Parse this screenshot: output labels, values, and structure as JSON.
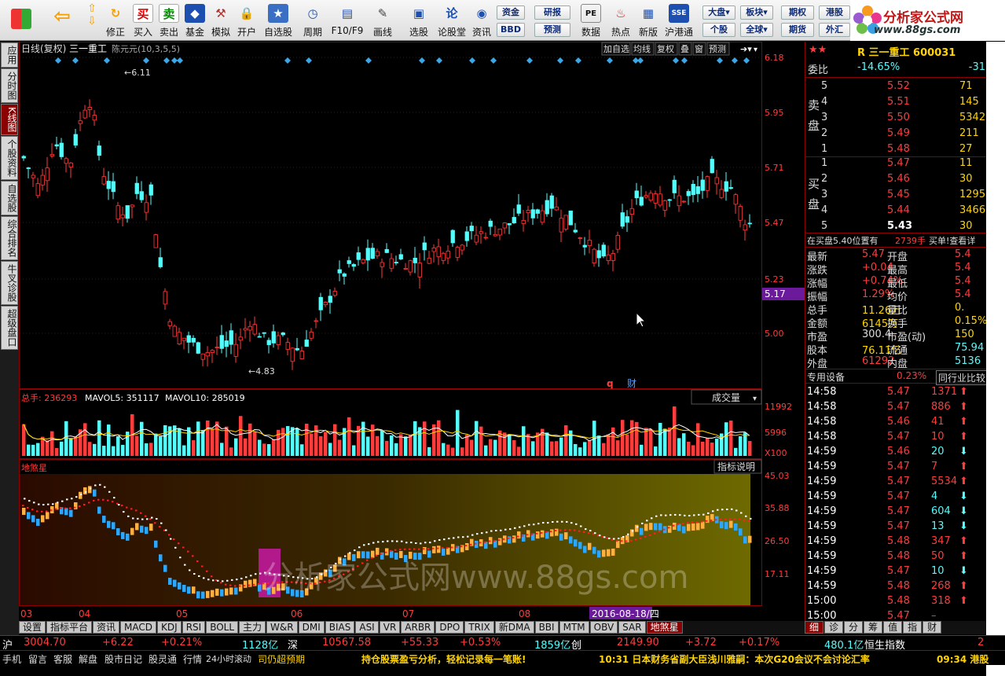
{
  "toolbar": {
    "items": [
      "修正",
      "买入",
      "卖出",
      "基金",
      "模拟",
      "开户",
      "自选股",
      "周期",
      "F10/F9",
      "画线",
      "选股",
      "论股堂",
      "资讯",
      "数据",
      "热点",
      "新版",
      "沪港通"
    ],
    "small_buttons": [
      "资金",
      "BBD",
      "研报",
      "预测",
      "大盘",
      "个股",
      "板块",
      "全球",
      "期权",
      "期货",
      "港股",
      "外汇"
    ],
    "logo": {
      "title": "分析家公式网",
      "url": "www.88gs.com"
    }
  },
  "sidetabs": [
    "应用",
    "分时图",
    "K线图",
    "个股资料",
    "自选股",
    "综合排名",
    "牛叉诊股",
    "超级盘口"
  ],
  "chart": {
    "header": {
      "period": "日线(复权)",
      "stock": "三一重工",
      "ma_label": "陈元元(10,3,5,5)"
    },
    "buttons": [
      "加自选",
      "均线",
      "复权",
      "叠",
      "窗",
      "预测"
    ],
    "price_axis": [
      "6.18",
      "5.95",
      "5.71",
      "5.47",
      "5.23",
      "5.00"
    ],
    "current_price": "5.17",
    "high_label": "6.11",
    "low_label": "4.83",
    "markers": {
      "q": "q",
      "cai": "财"
    },
    "volume": {
      "label": "总手: 236293",
      "mavol5": "MAVOL5: 351117",
      "mavol10": "MAVOL10: 285019",
      "title": "成交量",
      "axis": [
        "11992",
        "5996",
        "X100"
      ]
    },
    "indicator": {
      "name": "地煞星",
      "button": "指标说明",
      "axis": [
        "45.03",
        "35.88",
        "26.50",
        "17.11"
      ],
      "watermark": "分析家公式网www.88gs.com"
    },
    "dates": [
      "03",
      "04",
      "05",
      "06",
      "07",
      "08"
    ],
    "date_highlight": "2016-08-18/四"
  },
  "chart_data": {
    "type": "candlestick",
    "title": "三一重工 日线(复权)",
    "ylim": [
      4.83,
      6.18
    ],
    "high": 6.11,
    "low": 4.83,
    "last": 5.47,
    "current_line": 5.17,
    "volume_max": 11992,
    "indicator_range": [
      8,
      45.03
    ]
  },
  "quote": {
    "stock_code": "R 三一重工 600031",
    "weibi_label": "委比",
    "weibi": "-14.65%",
    "weicha": "-31",
    "sell_label": "卖盘",
    "buy_label": "买盘",
    "sell": [
      [
        "5",
        "5.52",
        "71"
      ],
      [
        "4",
        "5.51",
        "145"
      ],
      [
        "3",
        "5.50",
        "5342"
      ],
      [
        "2",
        "5.49",
        "211"
      ],
      [
        "1",
        "5.48",
        "27"
      ]
    ],
    "buy": [
      [
        "1",
        "5.47",
        "11"
      ],
      [
        "2",
        "5.46",
        "30"
      ],
      [
        "3",
        "5.45",
        "1295"
      ],
      [
        "4",
        "5.44",
        "3466"
      ],
      [
        "5",
        "5.43",
        "30"
      ]
    ],
    "note": "在买盘5.40位置有",
    "note_hand": "2739手",
    "note_tail": "买单!查看详",
    "stats": [
      [
        "最新",
        "5.47",
        "开盘",
        "5.4"
      ],
      [
        "涨跌",
        "+0.04",
        "最高",
        "5.4"
      ],
      [
        "涨幅",
        "+0.74%",
        "最低",
        "5.4"
      ],
      [
        "振幅",
        "1.29%",
        "均价",
        "5.4"
      ],
      [
        "总手",
        "11.26万",
        "量比",
        "0."
      ],
      [
        "金额",
        "6145万",
        "换手",
        "0.15%"
      ],
      [
        "市盈",
        "300.4",
        "市盈(动)",
        "150"
      ],
      [
        "股本",
        "76.11亿",
        "流通",
        "75.94"
      ],
      [
        "外盘",
        "61292",
        "内盘",
        "5136"
      ]
    ],
    "device_label": "专用设备",
    "device_pct": "0.23%",
    "compare": "同行业比较",
    "ticks": [
      [
        "14:58",
        "5.47",
        "1371",
        "up"
      ],
      [
        "14:58",
        "5.47",
        "886",
        "up"
      ],
      [
        "14:58",
        "5.46",
        "41",
        "up"
      ],
      [
        "14:58",
        "5.47",
        "10",
        "up"
      ],
      [
        "14:59",
        "5.46",
        "20",
        "down"
      ],
      [
        "14:59",
        "5.47",
        "7",
        "up"
      ],
      [
        "14:59",
        "5.47",
        "5534",
        "up"
      ],
      [
        "14:59",
        "5.47",
        "4",
        "down"
      ],
      [
        "14:59",
        "5.47",
        "604",
        "down"
      ],
      [
        "14:59",
        "5.47",
        "13",
        "down"
      ],
      [
        "14:59",
        "5.48",
        "347",
        "up"
      ],
      [
        "14:59",
        "5.48",
        "50",
        "up"
      ],
      [
        "14:59",
        "5.47",
        "10",
        "down"
      ],
      [
        "14:59",
        "5.48",
        "268",
        "up"
      ],
      [
        "15:00",
        "5.48",
        "318",
        "up"
      ],
      [
        "15:00",
        "5.47",
        "–",
        "none"
      ]
    ]
  },
  "bottom_tabs": [
    "设置",
    "指标平台",
    "资讯",
    "MACD",
    "KDJ",
    "RSI",
    "BOLL",
    "主力",
    "W&R",
    "DMI",
    "BIAS",
    "ASI",
    "VR",
    "ARBR",
    "DPO",
    "TRIX",
    "新DMA",
    "BBI",
    "MTM",
    "OBV",
    "SAR",
    "地煞星"
  ],
  "right_tabs": [
    "细",
    "诊",
    "分",
    "筹",
    "值",
    "指",
    "财"
  ],
  "status": {
    "sh": "沪",
    "sh_val": "3004.70",
    "sh_chg": "+6.22",
    "sh_pct": "+0.21%",
    "sh_amt": "1128亿",
    "sz": "深",
    "sz_val": "10567.58",
    "sz_chg": "+55.33",
    "sz_pct": "+0.53%",
    "sz_amt": "1859亿",
    "cy": "创",
    "cy_val": "2149.90",
    "cy_chg": "+3.72",
    "cy_pct": "+0.17%",
    "hk_amt": "480.1亿",
    "hk": "恒生指数",
    "hk_v": "2"
  },
  "bottom_bar": {
    "items": [
      "手机",
      "留言",
      "客服",
      "解盘",
      "股市日记",
      "股灵通",
      "行情",
      "24小时滚动"
    ],
    "ticker1": "司仍超预期",
    "ticker2": "持仓股票盈亏分析，轻松记录每一笔账!",
    "ticker3": "10:31 日本财务省副大臣浅川雅嗣：本次G20会议不会讨论汇率",
    "time": "09:34 港股"
  },
  "colors": {
    "up": "#ff3c3c",
    "down": "#54fcfc",
    "bg": "#000000",
    "accent": "#8b0000"
  }
}
